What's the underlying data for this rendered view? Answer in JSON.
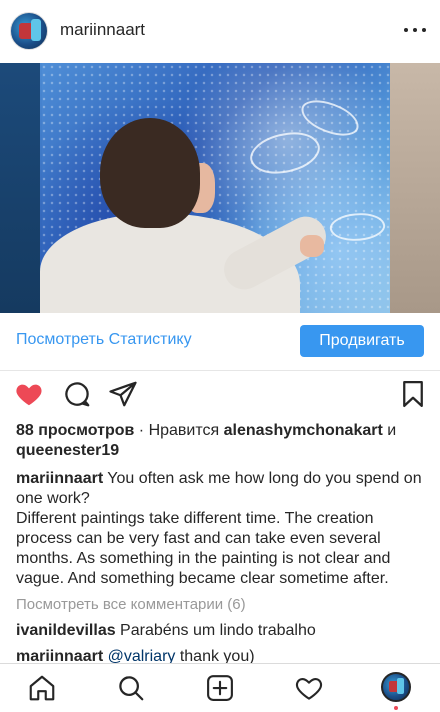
{
  "header": {
    "username": "mariinnaart",
    "more_icon": "more-horizontal-icon"
  },
  "post": {
    "image_alt_icon": "photo-painting",
    "stats_label": "Посмотреть Статистику",
    "promote_label": "Продвигать"
  },
  "actions": {
    "like_icon": "heart-filled-icon",
    "like_color": "#ed4956",
    "comment_icon": "comment-icon",
    "share_icon": "direct-share-icon",
    "save_icon": "bookmark-icon"
  },
  "engagement": {
    "views": "88 просмотров",
    "separator": " · Нравится ",
    "liker1": "alenashymchonakart",
    "and": " и",
    "liker2": "queenester19"
  },
  "caption": {
    "author": "mariinnaart",
    "line1": " You often ask me how long do you spend on one work?",
    "line2": "Different paintings take different time. The creation process can be very fast and can take even several months. As something in the painting is not clear and vague. And something became clear sometime after."
  },
  "comments": {
    "view_all": "Посмотреть все комментарии (6)",
    "items": [
      {
        "author": "ivanildevillas",
        "text": " Parabéns um lindo trabalho"
      },
      {
        "author": "mariinnaart",
        "mention": " @valriary",
        "text": " thank you)"
      }
    ]
  },
  "bottom_nav": {
    "home_icon": "home-icon",
    "search_icon": "search-icon",
    "add_icon": "add-post-icon",
    "activity_icon": "heart-outline-icon",
    "profile_icon": "profile-avatar"
  },
  "colors": {
    "accent": "#3897f0",
    "text": "#262626",
    "muted": "#999999",
    "like": "#ed4956"
  }
}
